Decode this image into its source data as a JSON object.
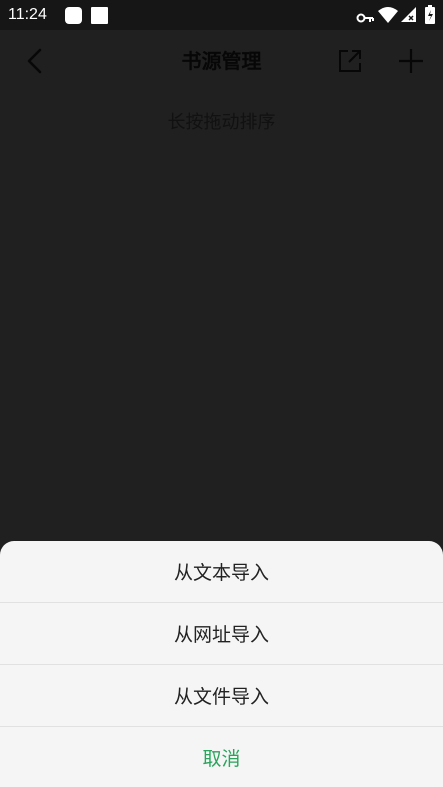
{
  "status_bar": {
    "time": "11:24",
    "icons": [
      "notification-square-icon",
      "notification-square-icon",
      "vpn-key-icon",
      "wifi-icon",
      "signal-icon",
      "battery-icon"
    ]
  },
  "app_bar": {
    "title": "书源管理",
    "icons": [
      "back-arrow-icon",
      "export-icon",
      "add-icon"
    ]
  },
  "main": {
    "hint": "长按拖动排序"
  },
  "bottom_sheet": {
    "options": [
      {
        "label": "从文本导入"
      },
      {
        "label": "从网址导入"
      },
      {
        "label": "从文件导入"
      }
    ],
    "cancel_label": "取消"
  },
  "colors": {
    "background": "#202020",
    "sheet": "#f5f5f5",
    "cancel": "#2aa35c"
  }
}
